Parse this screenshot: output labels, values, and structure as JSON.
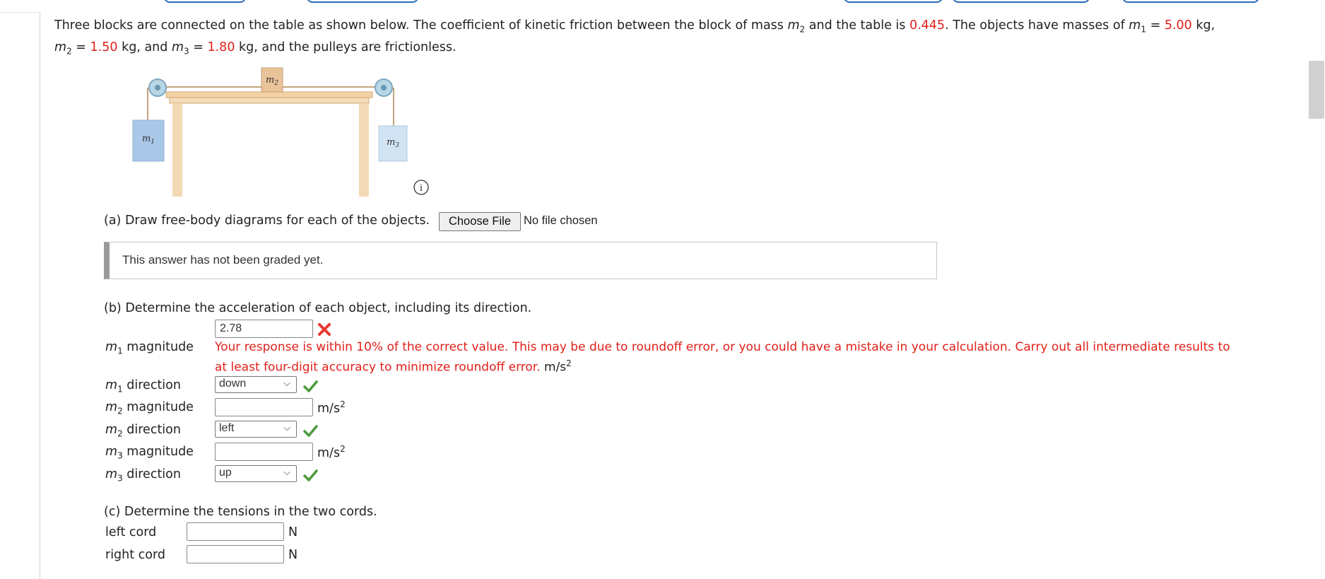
{
  "problem": {
    "intro_1": "Three blocks are connected on the table as shown below. The coefficient of kinetic friction between the block of mass ",
    "intro_2": " and the table is ",
    "mu": "0.445",
    "intro_3": ". The objects have masses of ",
    "m1_value": "5.00",
    "m2_value": "1.50",
    "m3_value": "1.80",
    "kg": "kg,",
    "kg_and": "kg, and",
    "kg_end": "kg, and the pulleys are frictionless.",
    "equals": "=",
    "var_m": "m",
    "sub1": "1",
    "sub2": "2",
    "sub3": "3"
  },
  "figure": {
    "label_m1": "m",
    "label_m2": "m",
    "label_m3": "m",
    "info_icon": "info-icon"
  },
  "part_a": {
    "prompt": "(a) Draw free-body diagrams for each of the objects.",
    "file_button": "Choose File",
    "file_status": "No file chosen",
    "grade_message": "This answer has not been graded yet."
  },
  "part_b": {
    "prompt": "(b) Determine the acceleration of each object, including its direction.",
    "m1_magnitude_label": "magnitude",
    "m1_magnitude_value": "2.78",
    "feedback_1": "Your response is within 10% of the correct value. This may be due to roundoff error, or you could have a mistake in your calculation. Carry out all intermediate results to",
    "feedback_2": "at least four-digit accuracy to minimize roundoff error.",
    "unit": "m/s",
    "unit_sup": "2",
    "direction_label": "direction",
    "m1_direction": "down",
    "m2_magnitude_label": "magnitude",
    "m2_magnitude_value": "",
    "m2_direction": "left",
    "m3_magnitude_label": "magnitude",
    "m3_magnitude_value": "",
    "m3_direction": "up"
  },
  "part_c": {
    "prompt": "(c) Determine the tensions in the two cords.",
    "left_label": "left cord",
    "left_value": "",
    "right_label": "right cord",
    "right_value": "",
    "unit": "N"
  },
  "colors": {
    "red": "#e0201a",
    "check_green": "#4a9a3a",
    "x_red": "#e8382f"
  }
}
